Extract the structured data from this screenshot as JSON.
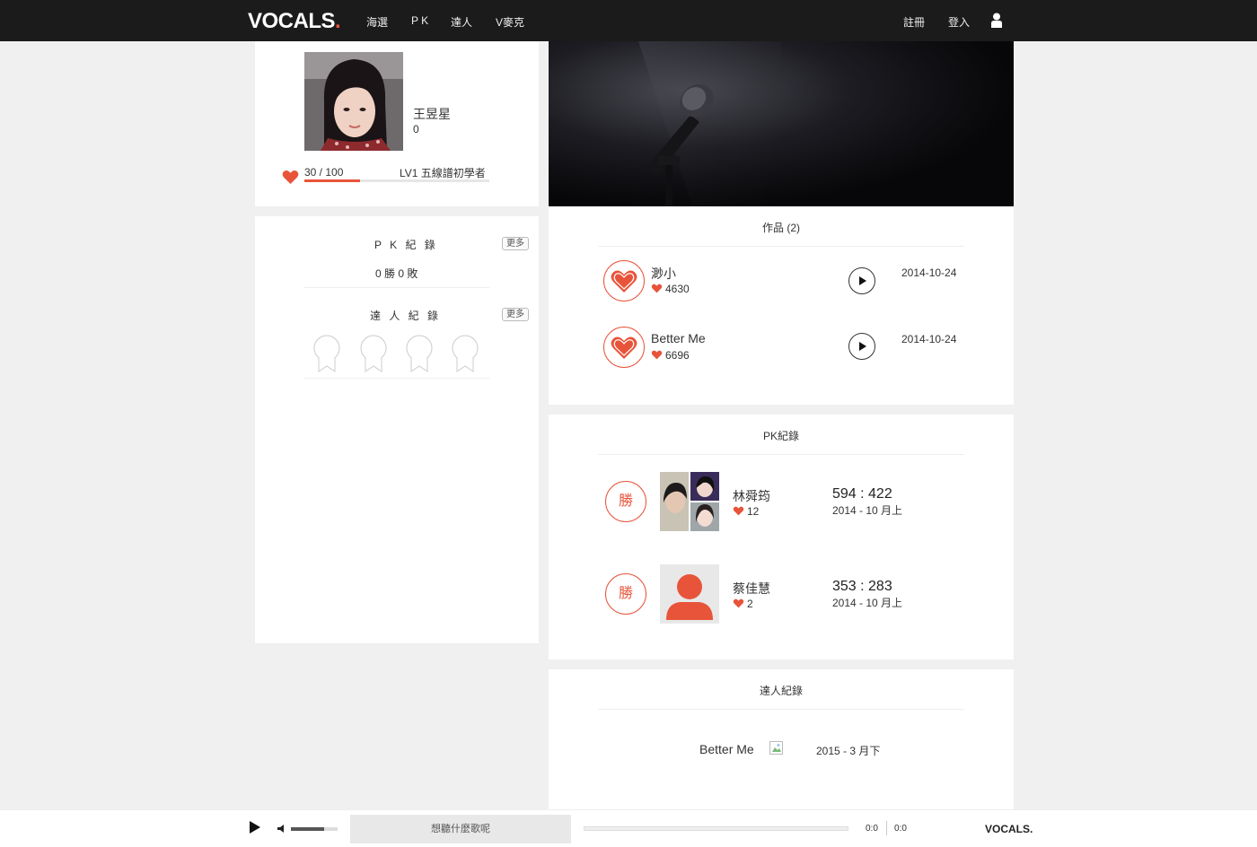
{
  "nav": {
    "logo": "VOCALS",
    "logo_dot": ".",
    "links": [
      "海選",
      "P K",
      "達人",
      "V麥克"
    ],
    "register": "註冊",
    "login": "登入"
  },
  "profile": {
    "name": "王昱星",
    "score": "0",
    "xp": "30 / 100",
    "xp_fraction": 0.3,
    "level": "LV1 五線譜初學者"
  },
  "side": {
    "pk_title": "P K 紀 錄",
    "pk_record": "0 勝 0 敗",
    "master_title": "達 人 紀 錄",
    "more": "更多"
  },
  "works": {
    "title": "作品 (2)",
    "items": [
      {
        "name": "渺小",
        "likes": "4630",
        "date": "2014-10-24"
      },
      {
        "name": "Better Me",
        "likes": "6696",
        "date": "2014-10-24"
      }
    ]
  },
  "pk": {
    "title": "PK紀錄",
    "items": [
      {
        "result": "勝",
        "name": "林舜筠",
        "likes": "12",
        "score": "594 : 422",
        "date": "2014 - 10 月上"
      },
      {
        "result": "勝",
        "name": "蔡佳慧",
        "likes": "2",
        "score": "353 : 283",
        "date": "2014 - 10 月上"
      }
    ]
  },
  "master": {
    "title": "達人紀錄",
    "song": "Better Me",
    "date": "2015 - 3 月下"
  },
  "player": {
    "now_playing": "想聽什麼歌呢",
    "time_current": "0:0",
    "time_total": "0:0",
    "volume_fraction": 0.72,
    "logo": "VOCALS."
  },
  "colors": {
    "accent": "#e8543a",
    "nav_bg": "#1b1b1b",
    "page_bg": "#f0f0f0"
  }
}
